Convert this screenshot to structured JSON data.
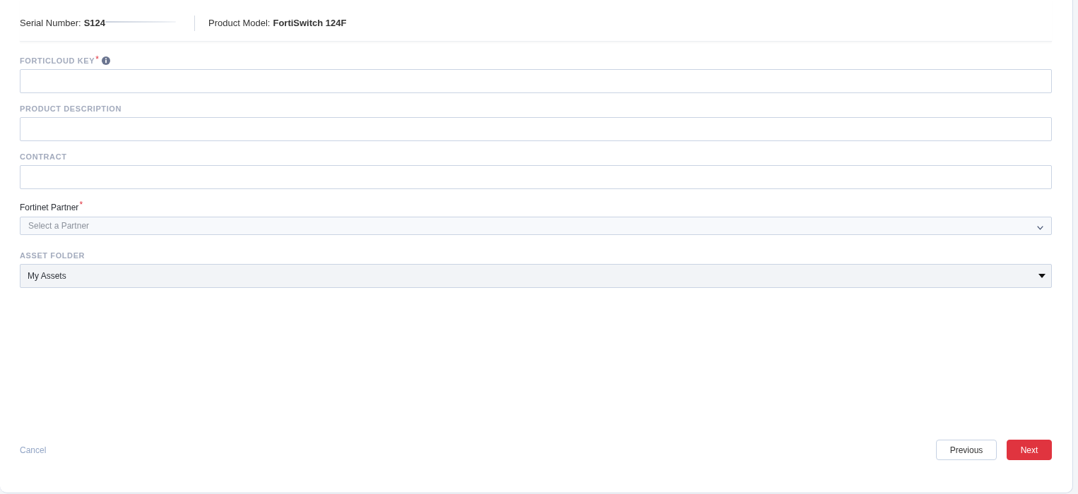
{
  "header": {
    "serial": {
      "label": "Serial Number:",
      "value": "S124"
    },
    "model": {
      "label": "Product Model:",
      "value": "FortiSwitch 124F"
    }
  },
  "fields": [
    {
      "kind": "text",
      "label": "FORTICLOUD KEY",
      "required_mark": "*",
      "info": true
    },
    {
      "kind": "text",
      "label": "PRODUCT DESCRIPTION",
      "info": false
    },
    {
      "kind": "text",
      "label": "CONTRACT",
      "info": false
    },
    {
      "kind": "combobox",
      "label": "Fortinet Partner",
      "required_mark": "*",
      "info": false,
      "placeholder": "Select a Partner"
    },
    {
      "kind": "dropdown",
      "label": "ASSET FOLDER",
      "info": false,
      "value": "My Assets"
    }
  ],
  "footer": {
    "cancel": "Cancel",
    "buttons": [
      {
        "kind": "secondary",
        "label": "Previous"
      },
      {
        "kind": "primary",
        "label": "Next"
      }
    ]
  }
}
